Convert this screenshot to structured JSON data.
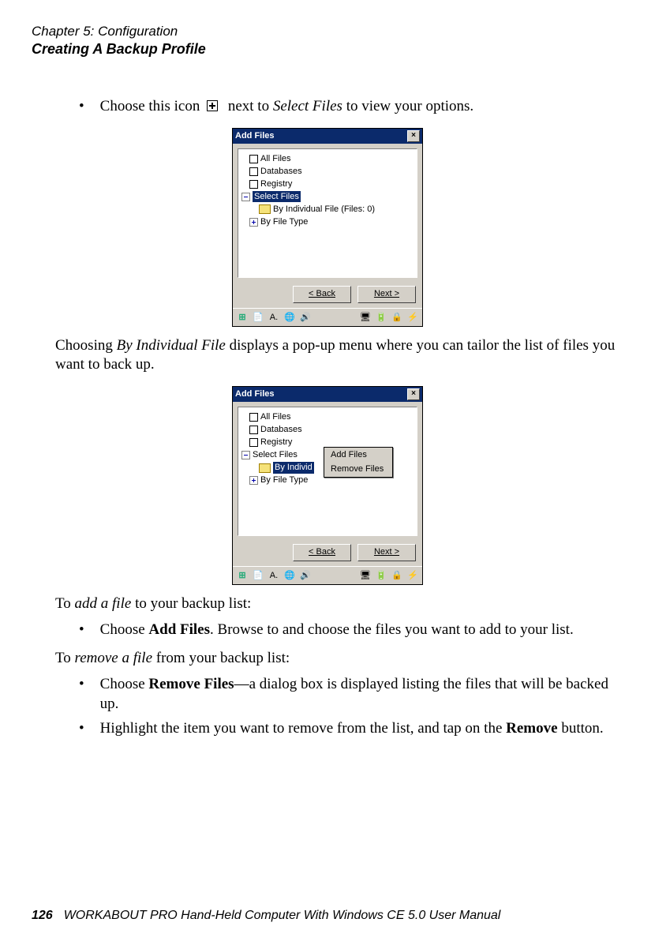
{
  "header": {
    "chapter": "Chapter 5: Configuration",
    "section": "Creating A Backup Profile"
  },
  "intro": {
    "prefix": "Choose this icon",
    "middle": "next to",
    "select_files": "Select Files",
    "suffix": "to view your options."
  },
  "dlg1": {
    "title": "Add Files",
    "rows": {
      "all": "All Files",
      "db": "Databases",
      "reg": "Registry",
      "sel": "Select Files",
      "byfile": "By Individual File (Files:   0)",
      "bytype": "By File Type"
    },
    "back": "< Back",
    "next": "Next >"
  },
  "para_mid": {
    "t1": "Choosing ",
    "t2": "By Individual File",
    "t3": " displays a pop-up menu where you can tailor the list of files you want to back up."
  },
  "dlg2": {
    "title": "Add Files",
    "rows": {
      "all": "All Files",
      "db": "Databases",
      "reg": "Registry",
      "sel": "Select Files",
      "byfile": "By Individ",
      "bytype": "By File Type"
    },
    "menu": {
      "add": "Add Files",
      "remove": "Remove Files"
    },
    "back": "< Back",
    "next": "Next >"
  },
  "add_section": {
    "lead_t1": "To ",
    "lead_t2": "add a file",
    "lead_t3": " to your backup list:",
    "b_t1": "Choose ",
    "b_t2": "Add Files",
    "b_t3": ". Browse to and choose the files you want to add to your list."
  },
  "remove_section": {
    "lead_t1": "To ",
    "lead_t2": "remove a file",
    "lead_t3": " from your backup list:",
    "b1_t1": "Choose ",
    "b1_t2": "Remove Files",
    "b1_t3": "—a dialog box is displayed listing the files that will be backed up.",
    "b2_t1": "Highlight the item you want to remove from the list, and tap on the ",
    "b2_t2": "Remove",
    "b2_t3": " button."
  },
  "footer": {
    "page": "126",
    "title": "WORKABOUT PRO Hand-Held Computer With Windows CE 5.0 User Manual"
  },
  "taskbar": {
    "a": "A."
  }
}
